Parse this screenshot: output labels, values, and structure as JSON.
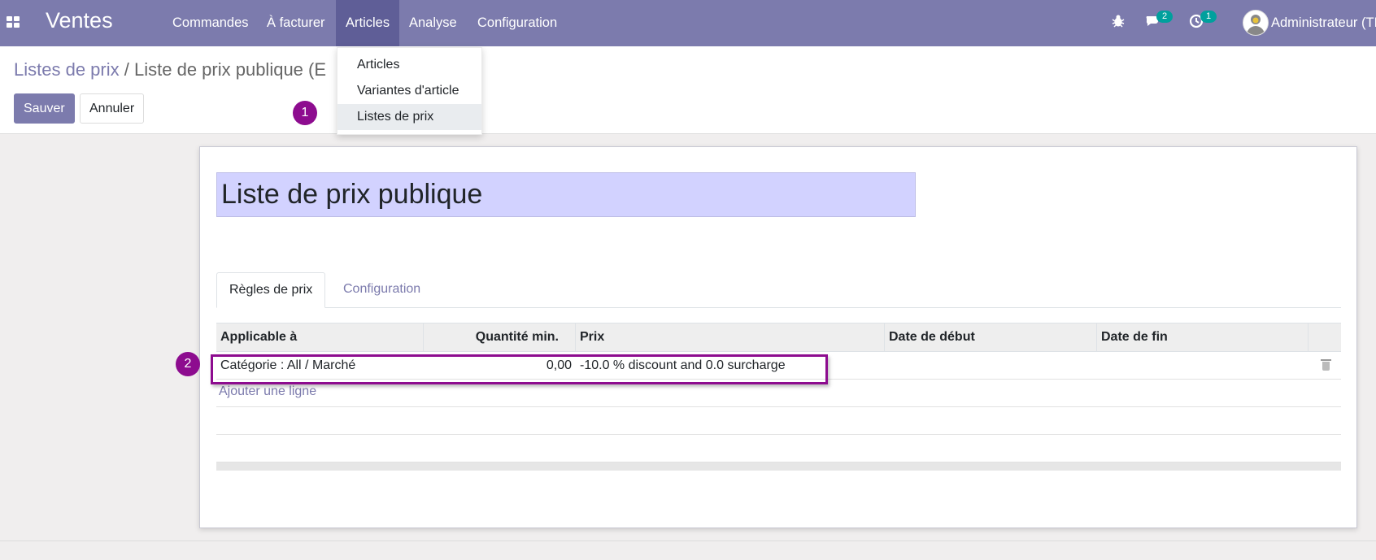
{
  "app": {
    "brand": "Ventes"
  },
  "navbar": {
    "menu": [
      {
        "label": "Commandes"
      },
      {
        "label": "À facturer"
      },
      {
        "label": "Articles",
        "active": true
      },
      {
        "label": "Analyse"
      },
      {
        "label": "Configuration"
      }
    ],
    "icons": {
      "bug": "bug-icon",
      "messages": "chat-icon",
      "activities": "clock-icon"
    },
    "messages_count": "2",
    "activities_count": "1",
    "user_name": "Administrateur (TI"
  },
  "dropdown": {
    "items": [
      {
        "label": "Articles"
      },
      {
        "label": "Variantes d'article"
      },
      {
        "label": "Listes de prix",
        "hovered": true
      }
    ]
  },
  "breadcrumb": {
    "parent": "Listes de prix",
    "separator": "/",
    "current": "Liste de prix publique (E"
  },
  "buttons": {
    "save": "Sauver",
    "discard": "Annuler"
  },
  "steps": {
    "one": "1",
    "two": "2"
  },
  "form": {
    "name": "Liste de prix publique",
    "tabs": [
      {
        "label": "Règles de prix",
        "active": true
      },
      {
        "label": "Configuration"
      }
    ],
    "table": {
      "columns": [
        "Applicable à",
        "Quantité min.",
        "Prix",
        "Date de début",
        "Date de fin"
      ],
      "rows": [
        {
          "applicable": "Catégorie : All / Marché",
          "min_qty": "0,00",
          "price": "-10.0 % discount and 0.0 surcharge",
          "date_start": "",
          "date_end": ""
        }
      ],
      "add_line": "Ajouter une ligne"
    }
  },
  "colors": {
    "navbar": "#7c7bad",
    "navbar_active": "#5f5e97",
    "primary": "#7c7bad",
    "badge": "#00a09d",
    "annotation": "#8d0c8f",
    "name_field": "#d2d2ff"
  }
}
